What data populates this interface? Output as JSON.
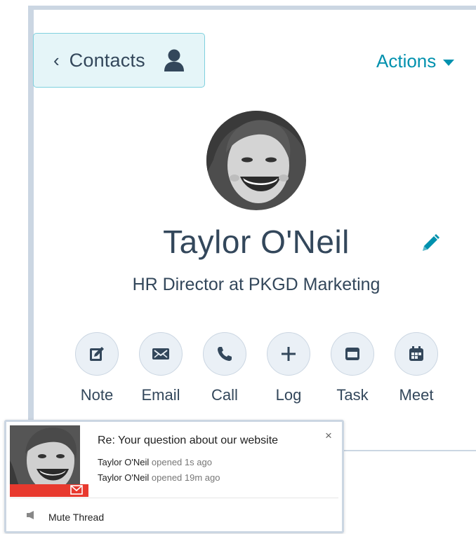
{
  "header": {
    "back_chevron": "‹",
    "back_label": "Contacts",
    "back_icon": "person-icon",
    "actions_label": "Actions"
  },
  "contact": {
    "name": "Taylor O'Neil",
    "title": "HR Director at PKGD Marketing"
  },
  "quick_actions": [
    {
      "label": "Note",
      "icon": "note-edit-icon"
    },
    {
      "label": "Email",
      "icon": "envelope-icon"
    },
    {
      "label": "Call",
      "icon": "phone-icon"
    },
    {
      "label": "Log",
      "icon": "plus-icon"
    },
    {
      "label": "Task",
      "icon": "task-icon"
    },
    {
      "label": "Meet",
      "icon": "calendar-icon"
    }
  ],
  "notification": {
    "subject": "Re: Your question about our website",
    "close": "×",
    "events": [
      {
        "who": "Taylor O'Neil",
        "what": "opened 1s ago"
      },
      {
        "who": "Taylor O'Neil",
        "what": "opened 19m ago"
      }
    ],
    "mute_label": "Mute Thread"
  },
  "colors": {
    "text": "#33475b",
    "accent": "#0091ae",
    "back_bg": "#e5f5f8",
    "back_border": "#7fd1de",
    "circle_bg": "#eaf0f6",
    "card_border": "#cbd6e2",
    "email_red": "#e8392e"
  }
}
